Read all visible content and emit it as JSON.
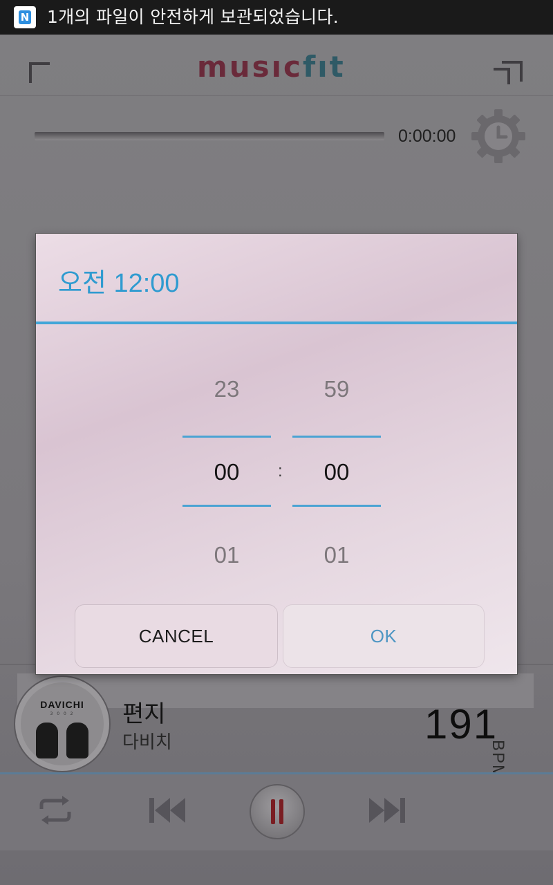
{
  "status_bar": {
    "app_badge": "N",
    "notification": "1개의 파일이 안전하게 보관되었습니다."
  },
  "app": {
    "logo_main": "musıc",
    "logo_fit": "fıt",
    "elapsed_time": "0:00:00",
    "progress": 0
  },
  "dialog": {
    "title": "오전 12:00",
    "hour": {
      "prev": "23",
      "current": "00",
      "next": "01"
    },
    "minute": {
      "prev": "59",
      "current": "00",
      "next": "01"
    },
    "separator": ":",
    "cancel_label": "CANCEL",
    "ok_label": "OK"
  },
  "now_playing": {
    "album_text": "DAVICHI",
    "album_subtext": "3 0 0 2",
    "title": "편지",
    "artist": "다비치",
    "bpm_value": "191",
    "bpm_label": "BPM"
  },
  "controls": {
    "icons": [
      "repeat-icon",
      "previous-icon",
      "pause-icon",
      "next-icon"
    ]
  },
  "colors": {
    "accent": "#41a6d8",
    "dialog_title": "#2f9bd0",
    "ok_text": "#4e96c3",
    "pause": "#7a1d22"
  }
}
